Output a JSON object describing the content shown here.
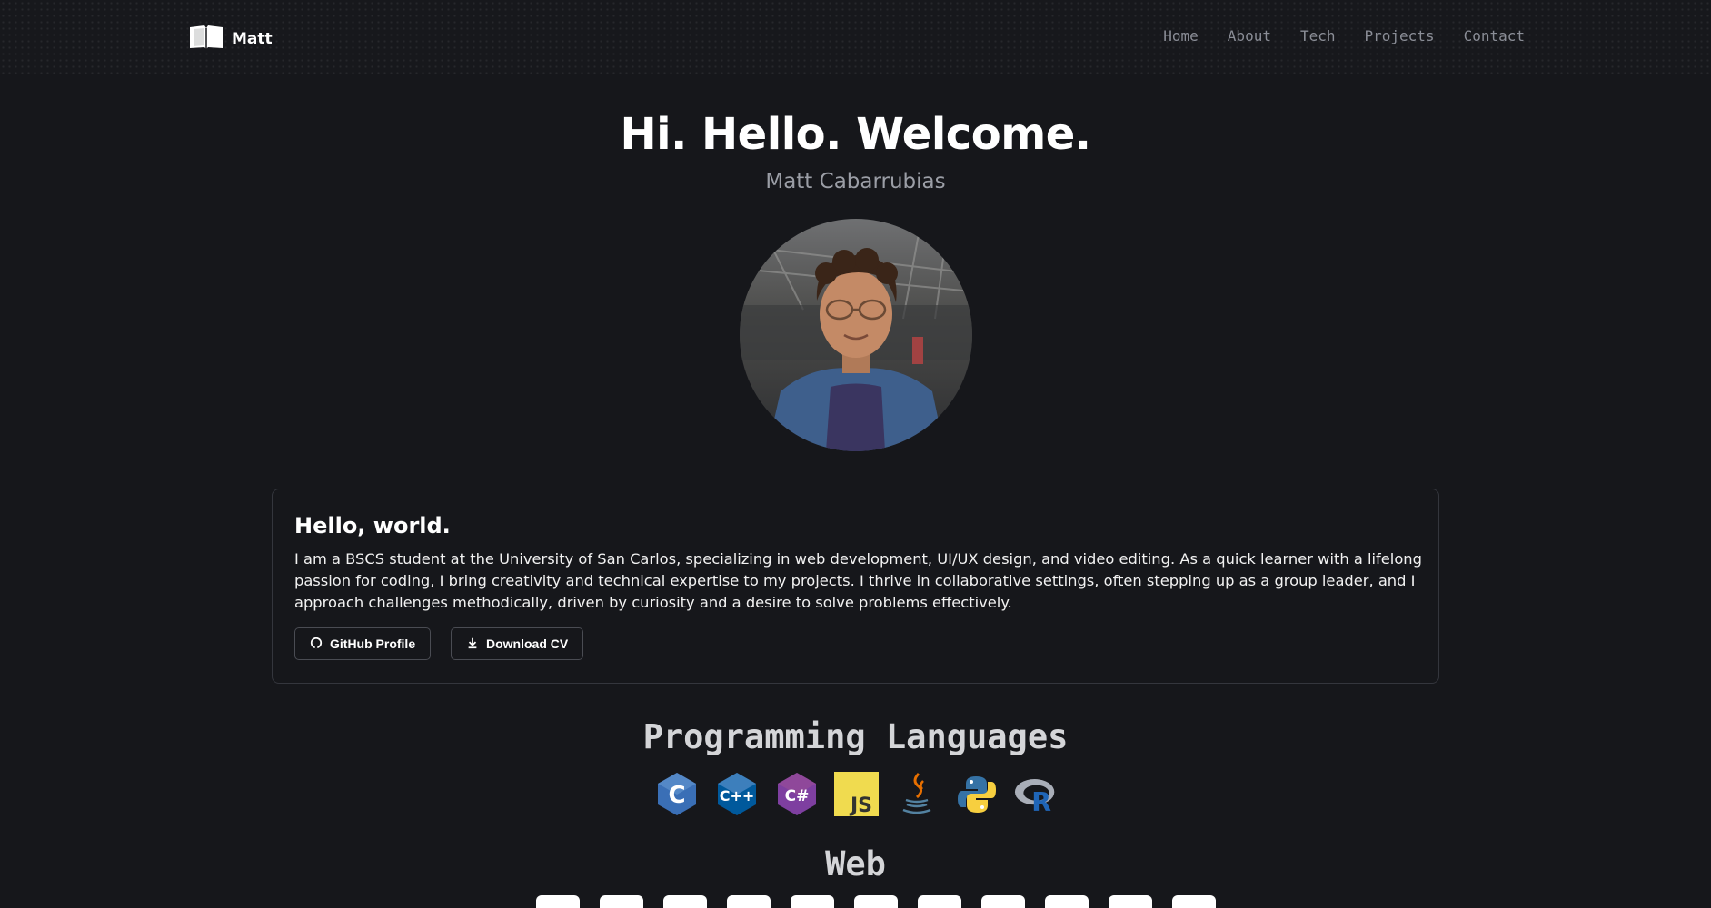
{
  "nav": {
    "brand": "Matt",
    "links": [
      "Home",
      "About",
      "Tech",
      "Projects",
      "Contact"
    ]
  },
  "hero": {
    "title": "Hi. Hello. Welcome.",
    "subtitle": "Matt Cabarrubias"
  },
  "about": {
    "heading": "Hello, world.",
    "body": "I am a BSCS student at the University of San Carlos, specializing in web development, UI/UX design, and video editing. As a quick learner with a lifelong passion for coding, I bring creativity and technical expertise to my projects. I thrive in collaborative settings, often stepping up as a group leader, and I approach challenges methodically, driven by curiosity and a desire to solve problems effectively.",
    "github_button": "GitHub Profile",
    "cv_button": "Download CV"
  },
  "sections": {
    "languages_title": "Programming Languages",
    "web_title": "Web"
  },
  "languages": {
    "c_label": "C",
    "cpp_label": "C++",
    "csharp_label": "C#",
    "js_label": "JS",
    "r_label": "R"
  },
  "icons": {
    "brand": "book-icon",
    "github": "github-icon",
    "download": "download-icon",
    "languages": [
      "c-icon",
      "cpp-icon",
      "csharp-icon",
      "javascript-icon",
      "java-icon",
      "python-icon",
      "r-icon"
    ],
    "web": [
      "html-icon",
      "css-icon",
      "web-tool-icon",
      "web-tool-icon",
      "web-tool-icon",
      "web-tool-icon",
      "web-tool-icon",
      "web-tool-icon",
      "web-tool-icon",
      "web-tool-icon",
      "web-tool-icon"
    ]
  },
  "colors": {
    "background": "#16171b",
    "muted_text": "#8a8d96",
    "card_border": "#34363d",
    "c_blue": "#3a6fb6",
    "csharp_purple": "#7e3fa0",
    "js_yellow": "#f0db4f",
    "java_red": "#e76f00",
    "python_blue": "#3572a5",
    "python_yellow": "#f7cf3f"
  }
}
